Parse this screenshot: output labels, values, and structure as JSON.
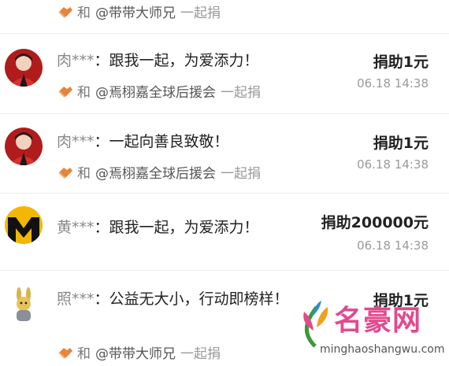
{
  "colors": {
    "accent": "#e8833a",
    "separator": "#ececec",
    "watermark": "#e24a8e"
  },
  "top_partial": {
    "with": "和",
    "group": "@带带大师兄",
    "tail": "一起捐"
  },
  "donations": [
    {
      "avatar": "person-red-avatar",
      "name": "肉***",
      "message": "：跟我一起，为爱添力！",
      "amount": "捐助1元",
      "time": "06.18 14:38",
      "with": "和",
      "group": "@焉栩嘉全球后援会",
      "tail": "一起捐"
    },
    {
      "avatar": "person-red-avatar",
      "name": "肉***",
      "message": "：一起向善良致敬！",
      "amount": "捐助1元",
      "time": "06.18 14:38",
      "with": "和",
      "group": "@焉栩嘉全球后援会",
      "tail": "一起捐"
    },
    {
      "avatar": "yellow-m-avatar",
      "name": "黄***",
      "message": "：跟我一起，为爱添力！",
      "amount": "捐助200000元",
      "time": "06.18 14:38"
    },
    {
      "avatar": "rabbit-toy-avatar",
      "name": "照***",
      "message": "：公益无大小，行动即榜样！",
      "amount": "捐助1元",
      "with": "和",
      "group": "@带带大师兄",
      "tail": "一起捐"
    }
  ],
  "watermark": {
    "title": "名豪网",
    "url": "minghaoshangwu.com"
  }
}
